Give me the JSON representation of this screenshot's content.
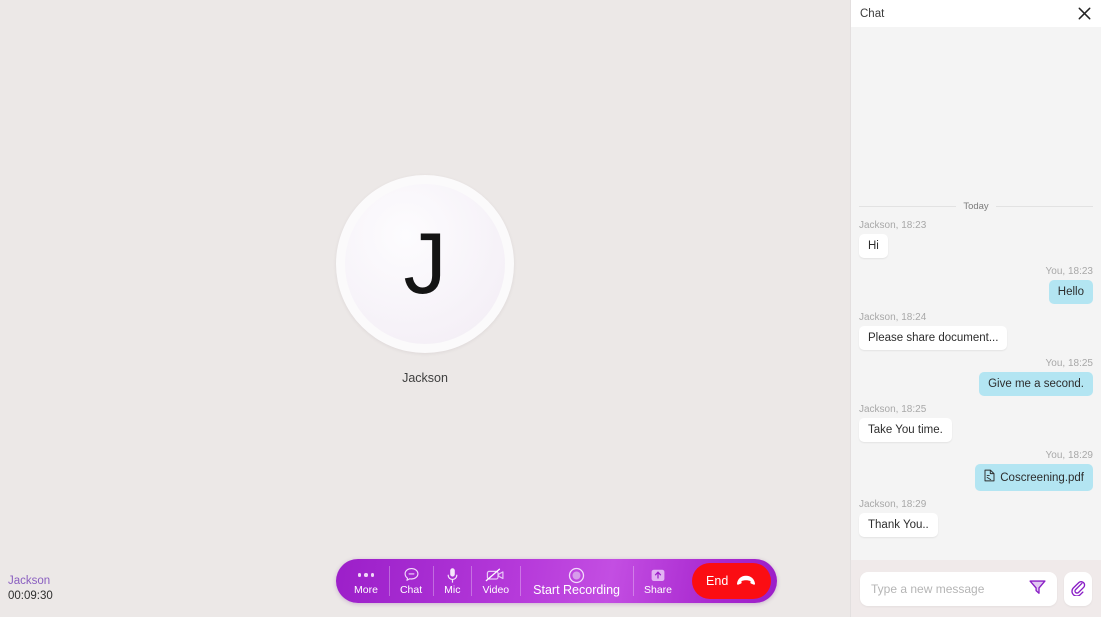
{
  "colors": {
    "stage_bg": "#ece8e7",
    "toolbar_purple": "#a52ad0",
    "end_red": "#fb0d13",
    "accent_purple": "#8a1fc6",
    "me_bubble": "#b3e5f2",
    "them_bubble": "#ffffff",
    "chat_bg": "#f4f4f4",
    "footer_bg": "#f0eaea"
  },
  "stage": {
    "participant": {
      "initial": "J",
      "name": "Jackson",
      "avatar_icon": "avatar-initial"
    },
    "call_info": {
      "name": "Jackson",
      "timer": "00:09:30"
    }
  },
  "toolbar": {
    "items": [
      {
        "label": "More",
        "icon": "more-dots-icon"
      },
      {
        "label": "Chat",
        "icon": "chat-bubble-icon"
      },
      {
        "label": "Mic",
        "icon": "microphone-icon"
      },
      {
        "label": "Video",
        "icon": "video-off-icon"
      },
      {
        "label": "Start Recording",
        "icon": "record-circle-icon"
      },
      {
        "label": "Share",
        "icon": "share-upload-icon"
      }
    ],
    "end_call": {
      "label": "End",
      "icon": "phone-hangup-icon"
    }
  },
  "chat": {
    "header": {
      "title": "Chat",
      "close_icon": "close-icon"
    },
    "day_divider": "Today",
    "messages": [
      {
        "side": "them",
        "meta": "Jackson, 18:23",
        "text": "Hi",
        "type": "text"
      },
      {
        "side": "me",
        "meta": "You, 18:23",
        "text": "Hello",
        "type": "text"
      },
      {
        "side": "them",
        "meta": "Jackson, 18:24",
        "text": "Please share document...",
        "type": "text"
      },
      {
        "side": "me",
        "meta": "You, 18:25",
        "text": "Give me a second.",
        "type": "text"
      },
      {
        "side": "them",
        "meta": "Jackson, 18:25",
        "text": "Take You time.",
        "type": "text"
      },
      {
        "side": "me",
        "meta": "You, 18:29",
        "text": "Coscreening.pdf",
        "type": "file",
        "file_icon": "pdf-file-icon"
      },
      {
        "side": "them",
        "meta": "Jackson, 18:29",
        "text": "Thank You..",
        "type": "text"
      }
    ],
    "composer": {
      "value": "",
      "placeholder": "Type a new message",
      "send_icon": "send-icon",
      "attach_icon": "paperclip-icon"
    }
  }
}
